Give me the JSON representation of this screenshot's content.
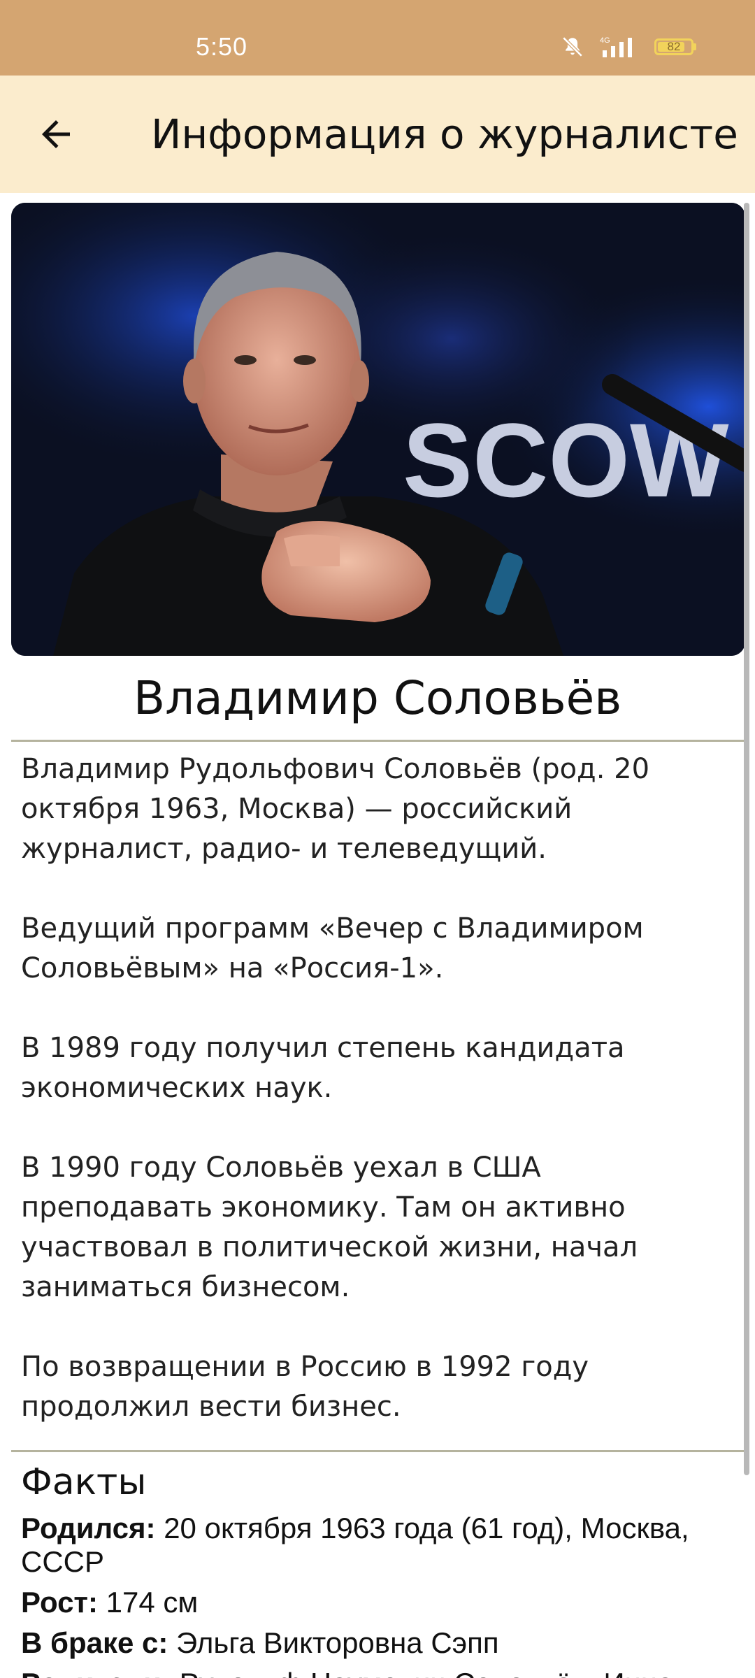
{
  "status_bar": {
    "time": "5:50",
    "network": "4G",
    "battery": "82",
    "battery_level": 0.82,
    "icons": [
      "bell-muted-icon",
      "signal-icon",
      "battery-icon"
    ]
  },
  "app_bar": {
    "title": "Информация о журналисте",
    "back_icon": "arrow-left-icon"
  },
  "profile": {
    "name": "Владимир Соловьёв",
    "photo_backdrop_text": "SCOW",
    "bio": [
      "Владимир Рудольфович Соловьёв (род. 20 октября 1963, Москва) — российский журналист, радио- и телеведущий.",
      "Ведущий программ «Вечер с Владимиром Соловьёвым» на «Россия-1».",
      "В 1989 году получил степень кандидата экономических наук.",
      "В 1990 году Соловьёв уехал в США преподавать экономику. Там он активно участвовал в политической жизни, начал заниматься бизнесом.",
      "По возвращении в Россию в 1992 году продолжил вести бизнес."
    ]
  },
  "facts": {
    "title": "Факты",
    "items": [
      {
        "label": "Родился:",
        "value": " 20 октября 1963 года (61 год), Москва, СССР"
      },
      {
        "label": "Рост:",
        "value": " 174 см"
      },
      {
        "label": "В браке с:",
        "value": " Эльга Викторовна Сэпп"
      },
      {
        "label": "Родители:",
        "value": " Рудольф Наумович Соловьёв, Инна"
      }
    ]
  },
  "colors": {
    "status_bar": "#d4a571",
    "app_bar": "#fbeccd",
    "divider": "#b5b39e",
    "battery": "#f2d35b"
  }
}
